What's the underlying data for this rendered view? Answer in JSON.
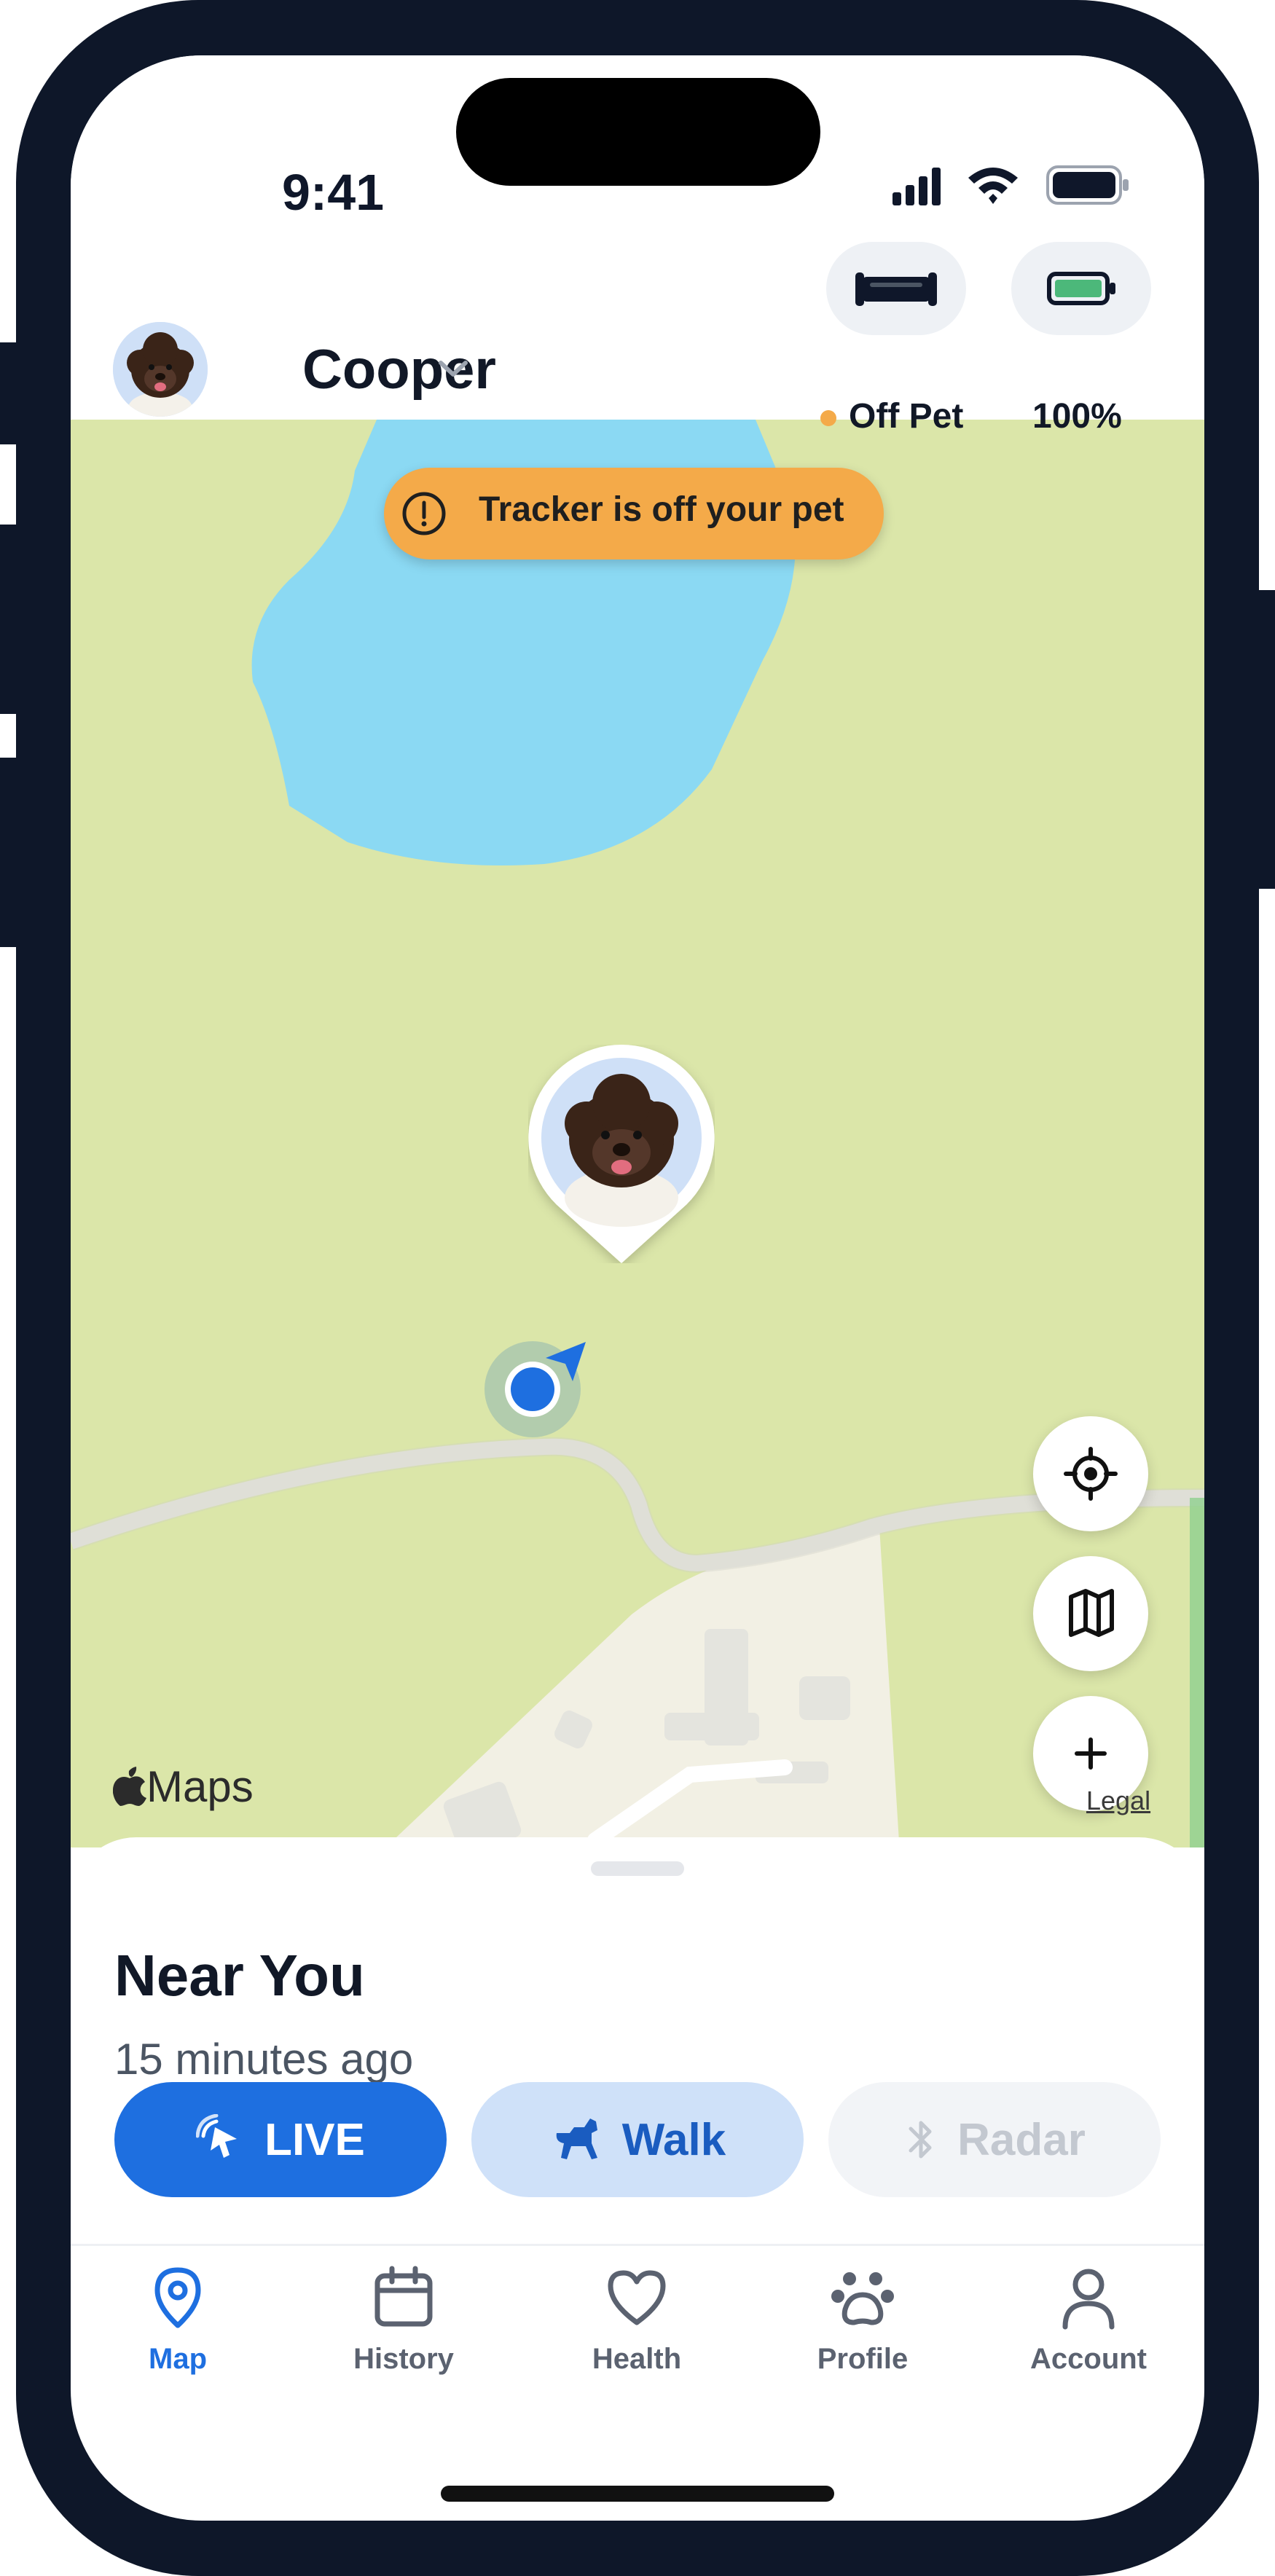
{
  "status_bar": {
    "time": "9:41"
  },
  "header": {
    "pet_name": "Cooper",
    "tracker_status_label": "Off Pet",
    "battery_label": "100%"
  },
  "map": {
    "banner_text": "Tracker is off your pet",
    "maps_logo_text": "Maps",
    "legal_text": "Legal"
  },
  "sheet": {
    "title": "Near You",
    "subtitle": "15 minutes ago",
    "buttons": [
      {
        "label": "LIVE"
      },
      {
        "label": "Walk"
      },
      {
        "label": "Radar"
      }
    ]
  },
  "tabs": [
    {
      "label": "Map",
      "icon": "map-pin-icon",
      "active": true
    },
    {
      "label": "History",
      "icon": "calendar-icon",
      "active": false
    },
    {
      "label": "Health",
      "icon": "heart-icon",
      "active": false
    },
    {
      "label": "Profile",
      "icon": "paw-icon",
      "active": false
    },
    {
      "label": "Account",
      "icon": "person-icon",
      "active": false
    }
  ],
  "colors": {
    "accent": "#1e6fe0",
    "warning": "#f4aa49",
    "status_dot": "#f4aa49",
    "battery_fill": "#4cb87a",
    "map_grass": "#dbe6a9",
    "map_water": "#8bd9f3"
  },
  "battery_level": 1.0
}
